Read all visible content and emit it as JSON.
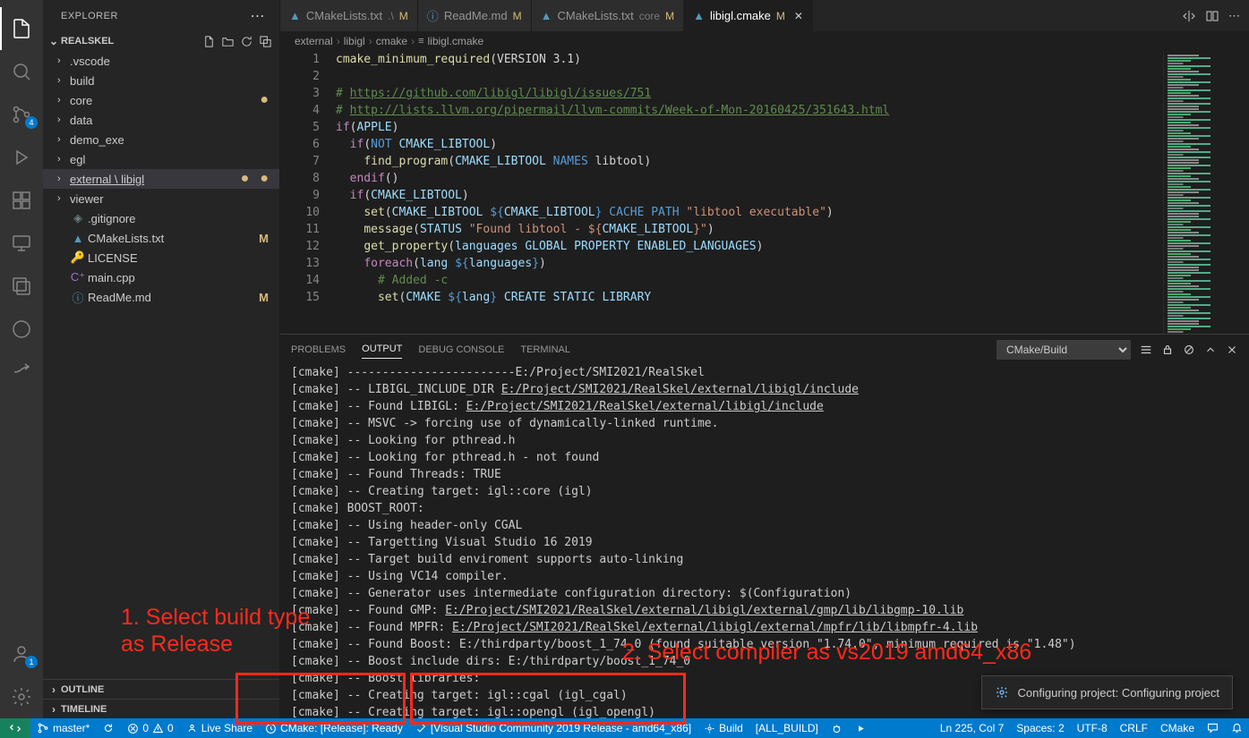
{
  "activity": {
    "badge_scm": "4",
    "badge_account": "1"
  },
  "sidebar": {
    "title": "EXPLORER",
    "root": "REALSKEL",
    "items": [
      {
        "label": ".vscode",
        "kind": "folder"
      },
      {
        "label": "build",
        "kind": "folder"
      },
      {
        "label": "core",
        "kind": "folder",
        "dot": true
      },
      {
        "label": "data",
        "kind": "folder"
      },
      {
        "label": "demo_exe",
        "kind": "folder"
      },
      {
        "label": "egl",
        "kind": "folder"
      },
      {
        "label": "external \\ libigl",
        "kind": "folder",
        "selected": true,
        "dot": true,
        "underline": true
      },
      {
        "label": "viewer",
        "kind": "folder"
      },
      {
        "label": ".gitignore",
        "kind": "file",
        "icon": "git"
      },
      {
        "label": "CMakeLists.txt",
        "kind": "file",
        "icon": "cmake",
        "mod": "M"
      },
      {
        "label": "LICENSE",
        "kind": "file",
        "icon": "license"
      },
      {
        "label": "main.cpp",
        "kind": "file",
        "icon": "cpp"
      },
      {
        "label": "ReadMe.md",
        "kind": "file",
        "icon": "md",
        "mod": "M"
      }
    ],
    "outline": "OUTLINE",
    "timeline": "TIMELINE"
  },
  "tabs": [
    {
      "label": "CMakeLists.txt",
      "suffix": ".\\",
      "mod": "M",
      "icon": "cmake"
    },
    {
      "label": "ReadMe.md",
      "mod": "M",
      "icon": "md"
    },
    {
      "label": "CMakeLists.txt",
      "suffix": "core",
      "mod": "M",
      "icon": "cmake"
    },
    {
      "label": "libigl.cmake",
      "mod": "M",
      "icon": "cmake",
      "active": true,
      "close": true
    }
  ],
  "breadcrumbs": [
    "external",
    "libigl",
    "cmake",
    "libigl.cmake"
  ],
  "code": {
    "start_line": 1,
    "lines": [
      [
        {
          "t": "cmake_minimum_required",
          "c": "fn"
        },
        {
          "t": "(",
          "c": "op"
        },
        {
          "t": "VERSION 3.1",
          "c": "op"
        },
        {
          "t": ")",
          "c": "op"
        }
      ],
      [],
      [
        {
          "t": "# ",
          "c": "cm"
        },
        {
          "t": "https://github.com/libigl/libigl/issues/751",
          "c": "link-cm"
        }
      ],
      [
        {
          "t": "# ",
          "c": "cm"
        },
        {
          "t": "http://lists.llvm.org/pipermail/llvm-commits/Week-of-Mon-20160425/351643.html",
          "c": "link-cm"
        }
      ],
      [
        {
          "t": "if",
          "c": "kw"
        },
        {
          "t": "(",
          "c": "op"
        },
        {
          "t": "APPLE",
          "c": "var"
        },
        {
          "t": ")",
          "c": "op"
        }
      ],
      [
        {
          "t": "  ",
          "c": "op"
        },
        {
          "t": "if",
          "c": "kw"
        },
        {
          "t": "(",
          "c": "op"
        },
        {
          "t": "NOT",
          "c": "const"
        },
        {
          "t": " CMAKE_LIBTOOL",
          "c": "var"
        },
        {
          "t": ")",
          "c": "op"
        }
      ],
      [
        {
          "t": "    ",
          "c": "op"
        },
        {
          "t": "find_program",
          "c": "fn"
        },
        {
          "t": "(",
          "c": "op"
        },
        {
          "t": "CMAKE_LIBTOOL ",
          "c": "var"
        },
        {
          "t": "NAMES",
          "c": "const"
        },
        {
          "t": " libtool",
          "c": "op"
        },
        {
          "t": ")",
          "c": "op"
        }
      ],
      [
        {
          "t": "  ",
          "c": "op"
        },
        {
          "t": "endif",
          "c": "kw"
        },
        {
          "t": "()",
          "c": "op"
        }
      ],
      [
        {
          "t": "  ",
          "c": "op"
        },
        {
          "t": "if",
          "c": "kw"
        },
        {
          "t": "(",
          "c": "op"
        },
        {
          "t": "CMAKE_LIBTOOL",
          "c": "var"
        },
        {
          "t": ")",
          "c": "op"
        }
      ],
      [
        {
          "t": "    ",
          "c": "op"
        },
        {
          "t": "set",
          "c": "fn"
        },
        {
          "t": "(",
          "c": "op"
        },
        {
          "t": "CMAKE_LIBTOOL ",
          "c": "var"
        },
        {
          "t": "${",
          "c": "const"
        },
        {
          "t": "CMAKE_LIBTOOL",
          "c": "var"
        },
        {
          "t": "}",
          "c": "const"
        },
        {
          "t": " CACHE",
          "c": "const"
        },
        {
          "t": " PATH",
          "c": "const"
        },
        {
          "t": " ",
          "c": "op"
        },
        {
          "t": "\"libtool executable\"",
          "c": "str"
        },
        {
          "t": ")",
          "c": "op"
        }
      ],
      [
        {
          "t": "    ",
          "c": "op"
        },
        {
          "t": "message",
          "c": "fn"
        },
        {
          "t": "(",
          "c": "op"
        },
        {
          "t": "STATUS ",
          "c": "var"
        },
        {
          "t": "\"Found libtool - ${",
          "c": "str"
        },
        {
          "t": "CMAKE_LIBTOOL",
          "c": "var"
        },
        {
          "t": "}\"",
          "c": "str"
        },
        {
          "t": ")",
          "c": "op"
        }
      ],
      [
        {
          "t": "    ",
          "c": "op"
        },
        {
          "t": "get_property",
          "c": "fn"
        },
        {
          "t": "(",
          "c": "op"
        },
        {
          "t": "languages GLOBAL PROPERTY ENABLED_LANGUAGES",
          "c": "var"
        },
        {
          "t": ")",
          "c": "op"
        }
      ],
      [
        {
          "t": "    ",
          "c": "op"
        },
        {
          "t": "foreach",
          "c": "kw"
        },
        {
          "t": "(",
          "c": "op"
        },
        {
          "t": "lang ",
          "c": "var"
        },
        {
          "t": "${",
          "c": "const"
        },
        {
          "t": "languages",
          "c": "var"
        },
        {
          "t": "}",
          "c": "const"
        },
        {
          "t": ")",
          "c": "op"
        }
      ],
      [
        {
          "t": "      ",
          "c": "op"
        },
        {
          "t": "# Added -c",
          "c": "cm"
        }
      ],
      [
        {
          "t": "      ",
          "c": "op"
        },
        {
          "t": "set",
          "c": "fn"
        },
        {
          "t": "(",
          "c": "op"
        },
        {
          "t": "CMAKE ",
          "c": "var"
        },
        {
          "t": "${",
          "c": "const"
        },
        {
          "t": "lang",
          "c": "var"
        },
        {
          "t": "}",
          "c": "const"
        },
        {
          "t": " CREATE STATIC LIBRARY",
          "c": "var"
        }
      ]
    ]
  },
  "panel": {
    "tabs": [
      "PROBLEMS",
      "OUTPUT",
      "DEBUG CONSOLE",
      "TERMINAL"
    ],
    "active": 1,
    "selector": "CMake/Build",
    "output": [
      {
        "p": "[cmake] ",
        "t": "------------------------E:/Project/SMI2021/RealSkel"
      },
      {
        "p": "[cmake] -- ",
        "t": "LIBIGL_INCLUDE_DIR ",
        "u": "E:/Project/SMI2021/RealSkel/external/libigl/include"
      },
      {
        "p": "[cmake] -- ",
        "t": "Found LIBIGL: ",
        "u": "E:/Project/SMI2021/RealSkel/external/libigl/include"
      },
      {
        "p": "[cmake] -- ",
        "t": "MSVC -> forcing use of dynamically-linked runtime."
      },
      {
        "p": "[cmake] -- ",
        "t": "Looking for pthread.h"
      },
      {
        "p": "[cmake] -- ",
        "t": "Looking for pthread.h - not found"
      },
      {
        "p": "[cmake] -- ",
        "t": "Found Threads: TRUE"
      },
      {
        "p": "[cmake] -- ",
        "t": "Creating target: igl::core (igl)"
      },
      {
        "p": "[cmake] ",
        "t": "BOOST_ROOT:"
      },
      {
        "p": "[cmake] -- ",
        "t": "Using header-only CGAL"
      },
      {
        "p": "[cmake] -- ",
        "t": "Targetting Visual Studio 16 2019"
      },
      {
        "p": "[cmake] -- ",
        "t": "Target build enviroment supports auto-linking"
      },
      {
        "p": "[cmake] -- ",
        "t": "Using VC14 compiler."
      },
      {
        "p": "[cmake] -- ",
        "t": "Generator uses intermediate configuration directory: $(Configuration)"
      },
      {
        "p": "[cmake] -- ",
        "t": "Found GMP: ",
        "u": "E:/Project/SMI2021/RealSkel/external/libigl/external/gmp/lib/libgmp-10.lib"
      },
      {
        "p": "[cmake] -- ",
        "t": "Found MPFR: ",
        "u": "E:/Project/SMI2021/RealSkel/external/libigl/external/mpfr/lib/libmpfr-4.lib"
      },
      {
        "p": "[cmake] -- ",
        "t": "Found Boost: E:/thirdparty/boost_1_74_0 (found suitable version \"1.74.0\", minimum required is \"1.48\")"
      },
      {
        "p": "[cmake] -- ",
        "t": "Boost include dirs: E:/thirdparty/boost_1_74_0"
      },
      {
        "p": "[cmake] -- ",
        "t": "Boost libraries:"
      },
      {
        "p": "[cmake] -- ",
        "t": "Creating target: igl::cgal (igl_cgal)"
      },
      {
        "p": "[cmake] -- ",
        "t": "Creating target: igl::opengl (igl_opengl)"
      }
    ]
  },
  "toast": "Configuring project: Configuring project",
  "status": {
    "branch": "master*",
    "sync": "↻",
    "errors": "0",
    "warnings": "0",
    "liveshare": "Live Share",
    "cmake_variant": "CMake: [Release]: Ready",
    "kit": "[Visual Studio Community 2019 Release - amd64_x86]",
    "build": "Build",
    "target": "[ALL_BUILD]",
    "ln": "Ln 225, Col 7",
    "spaces": "Spaces: 2",
    "encoding": "UTF-8",
    "eol": "CRLF",
    "lang": "CMake"
  },
  "annotations": {
    "a1_l1": "1. Select build type",
    "a1_l2": "as Release",
    "a2": "2. Select compiler as vs2019 amd64_x86"
  }
}
